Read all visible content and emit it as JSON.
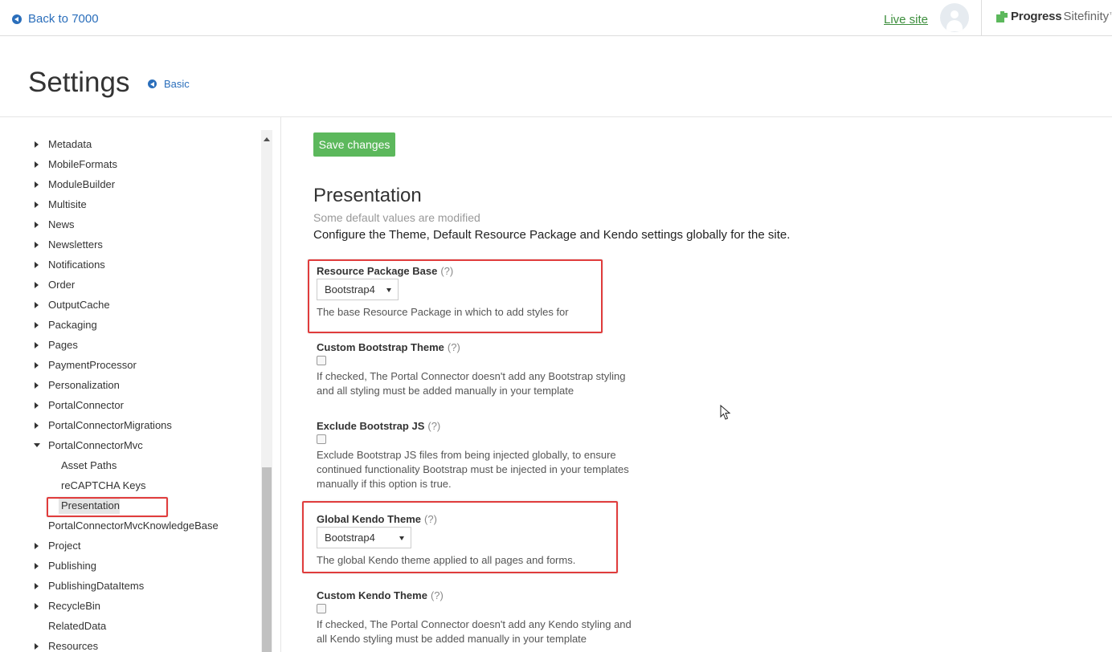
{
  "topbar": {
    "back_label": "Back to 7000",
    "live_site_label": "Live site",
    "brand_name": "Progress",
    "brand_product": "Sitefinity",
    "brand_tm": "™"
  },
  "header": {
    "title": "Settings",
    "basic_label": "Basic"
  },
  "sidebar": {
    "items": [
      {
        "label": "Metadata"
      },
      {
        "label": "MobileFormats"
      },
      {
        "label": "ModuleBuilder"
      },
      {
        "label": "Multisite"
      },
      {
        "label": "News"
      },
      {
        "label": "Newsletters"
      },
      {
        "label": "Notifications"
      },
      {
        "label": "Order"
      },
      {
        "label": "OutputCache"
      },
      {
        "label": "Packaging"
      },
      {
        "label": "Pages"
      },
      {
        "label": "PaymentProcessor"
      },
      {
        "label": "Personalization"
      },
      {
        "label": "PortalConnector"
      },
      {
        "label": "PortalConnectorMigrations"
      },
      {
        "label": "PortalConnectorMvc"
      },
      {
        "label": "Asset Paths"
      },
      {
        "label": "reCAPTCHA Keys"
      },
      {
        "label": "Presentation"
      },
      {
        "label": "PortalConnectorMvcKnowledgeBase"
      },
      {
        "label": "Project"
      },
      {
        "label": "Publishing"
      },
      {
        "label": "PublishingDataItems"
      },
      {
        "label": "RecycleBin"
      },
      {
        "label": "RelatedData"
      },
      {
        "label": "Resources"
      }
    ]
  },
  "main": {
    "save_label": "Save changes",
    "section_title": "Presentation",
    "section_subtitle": "Some default values are modified",
    "section_description": "Configure the Theme, Default Resource Package and Kendo settings globally for the site.",
    "help_marker": "(?)",
    "fields": {
      "resource_package": {
        "label": "Resource Package Base",
        "value": "Bootstrap4",
        "help": "The base Resource Package in which to add styles for"
      },
      "custom_bootstrap": {
        "label": "Custom Bootstrap Theme",
        "checked": false,
        "help": "If checked, The Portal Connector doesn't add any Bootstrap styling and all styling must be added manually in your template"
      },
      "exclude_bootstrap_js": {
        "label": "Exclude Bootstrap JS",
        "checked": false,
        "help": "Exclude Bootstrap JS files from being injected globally, to ensure continued functionality Bootstrap must be injected in your templates manually if this option is true."
      },
      "global_kendo": {
        "label": "Global Kendo Theme",
        "value": "Bootstrap4",
        "help": "The global Kendo theme applied to all pages and forms."
      },
      "custom_kendo": {
        "label": "Custom Kendo Theme",
        "checked": false,
        "help": "If checked, The Portal Connector doesn't add any Kendo styling and all Kendo styling must be added manually in your template"
      }
    }
  },
  "colors": {
    "accent": "#2a6ebb",
    "save_button": "#5cb85c",
    "live_site": "#3d8e3d",
    "highlight": "#e03c3c"
  }
}
